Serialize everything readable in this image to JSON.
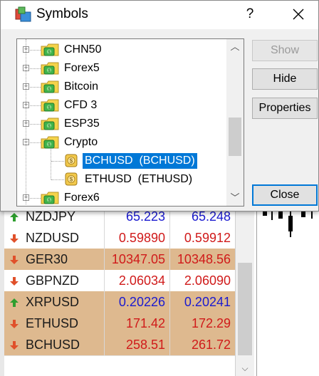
{
  "dialog": {
    "title": "Symbols",
    "help_label": "?",
    "buttons": {
      "show": "Show",
      "hide": "Hide",
      "properties": "Properties",
      "close": "Close"
    }
  },
  "tree": {
    "nodes": [
      {
        "label": "CHN50",
        "type": "folder",
        "expander": "+"
      },
      {
        "label": "Forex5",
        "type": "folder",
        "expander": "+"
      },
      {
        "label": "Bitcoin",
        "type": "folder",
        "expander": "+"
      },
      {
        "label": "CFD 3",
        "type": "folder",
        "expander": "+"
      },
      {
        "label": "ESP35",
        "type": "folder",
        "expander": "+"
      },
      {
        "label": "Crypto",
        "type": "folder",
        "expander": "−"
      },
      {
        "label": "BCHUSD  (BCHUSD)",
        "type": "symbol",
        "selected": true
      },
      {
        "label": "ETHUSD  (ETHUSD)",
        "type": "symbol",
        "selected": false
      },
      {
        "label": "Forex6",
        "type": "folder",
        "expander": "+"
      }
    ]
  },
  "market_watch": {
    "rows": [
      {
        "symbol": "NZDJPY",
        "bid": "65.223",
        "ask": "65.248",
        "direction": "up",
        "row_bg": "#ffffff",
        "bid_color": "#1a1ad0",
        "ask_color": "#1a1ad0"
      },
      {
        "symbol": "NZDUSD",
        "bid": "0.59890",
        "ask": "0.59912",
        "direction": "down",
        "row_bg": "#ffffff",
        "bid_color": "#d01a1a",
        "ask_color": "#d01a1a"
      },
      {
        "symbol": "GER30",
        "bid": "10347.05",
        "ask": "10348.56",
        "direction": "down",
        "row_bg": "#deb98f",
        "bid_color": "#d01a1a",
        "ask_color": "#d01a1a"
      },
      {
        "symbol": "GBPNZD",
        "bid": "2.06034",
        "ask": "2.06090",
        "direction": "down",
        "row_bg": "#ffffff",
        "bid_color": "#d01a1a",
        "ask_color": "#d01a1a"
      },
      {
        "symbol": "XRPUSD",
        "bid": "0.20226",
        "ask": "0.20241",
        "direction": "up",
        "row_bg": "#deb98f",
        "bid_color": "#1a1ad0",
        "ask_color": "#1a1ad0"
      },
      {
        "symbol": "ETHUSD",
        "bid": "171.42",
        "ask": "172.29",
        "direction": "down",
        "row_bg": "#deb98f",
        "bid_color": "#d01a1a",
        "ask_color": "#d01a1a"
      },
      {
        "symbol": "BCHUSD",
        "bid": "258.51",
        "ask": "261.72",
        "direction": "down",
        "row_bg": "#deb98f",
        "bid_color": "#d01a1a",
        "ask_color": "#d01a1a"
      }
    ]
  },
  "colors": {
    "accent": "#0078d7",
    "up_arrow": "#2e9e2e",
    "down_arrow": "#e0502a"
  }
}
